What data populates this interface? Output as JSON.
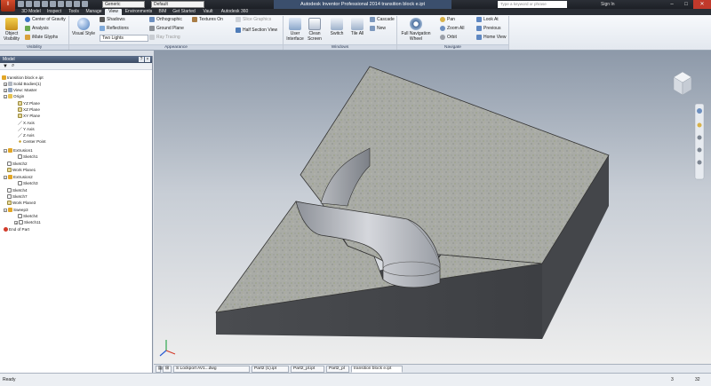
{
  "titlebar": {
    "app_letter": "I",
    "material_combo": "Generic",
    "appearance_combo": "Default",
    "title": "Autodesk Inventor Professional 2014   transition block e.ipt",
    "search_placeholder": "Type a keyword or phrase",
    "sign_in": "Sign In",
    "minimize": "–",
    "maximize": "□",
    "close": "✕"
  },
  "tabs": [
    "3D Model",
    "Inspect",
    "Tools",
    "Manage",
    "View",
    "Environments",
    "BIM",
    "Get Started",
    "Vault",
    "Autodesk 360"
  ],
  "ribbon": {
    "visibility": {
      "object_visibility": "Object Visibility",
      "center_of_gravity": "Center of Gravity",
      "analysis": "Analysis",
      "imate_glyphs": "iMate Glyphs",
      "label": "Visibility"
    },
    "appearance": {
      "visual_style": "Visual Style",
      "shadows": "Shadows",
      "reflections": "Reflections",
      "lights_combo": "Two Lights",
      "orthographic": "Orthographic",
      "ground_plane": "Ground Plane",
      "ray_tracing": "Ray Tracing",
      "textures_on": "Textures On",
      "slice_graphics": "Slice Graphics",
      "half_section_view": "Half Section View",
      "label": "Appearance"
    },
    "windows": {
      "user_interface": "User Interface",
      "clean_screen": "Clean Screen",
      "switch": "Switch",
      "tile_all": "Tile All",
      "cascade": "Cascade",
      "new": "New",
      "label": "Windows"
    },
    "navigate": {
      "full_navigation_wheel": "Full Navigation Wheel",
      "pan": "Pan",
      "zoom_all": "Zoom All",
      "orbit": "Orbit",
      "look_at": "Look At",
      "previous": "Previous",
      "home_view": "Home View",
      "label": "Navigate"
    }
  },
  "browser": {
    "title": "Model",
    "tree": [
      "transition block e.ipt",
      "Solid Bodies(1)",
      "View: Master",
      "Origin",
      "YZ Plane",
      "XZ Plane",
      "XY Plane",
      "X Axis",
      "Y Axis",
      "Z Axis",
      "Center Point",
      "Extrusion1",
      "Sketch1",
      "Sketch2",
      "Work Plane1",
      "Extrusion2",
      "Sketch3",
      "Sketch4",
      "Sketch7",
      "Work Plane3",
      "Sweep3",
      "Sketch4",
      "Sketch11",
      "End of Part"
    ]
  },
  "doc_tabs": [
    "S Lockport AV1...dwg",
    "Part2 (1).ipt",
    "Part2_pl.ipt",
    "Part2_pl",
    "transition block e.ipt"
  ],
  "status": {
    "text": "Ready",
    "count1": "3",
    "count2": "32"
  },
  "colors": {
    "accent": "#c93a1c",
    "title_bg": "#2b2f36",
    "viewport_top": "#8d99a9"
  }
}
